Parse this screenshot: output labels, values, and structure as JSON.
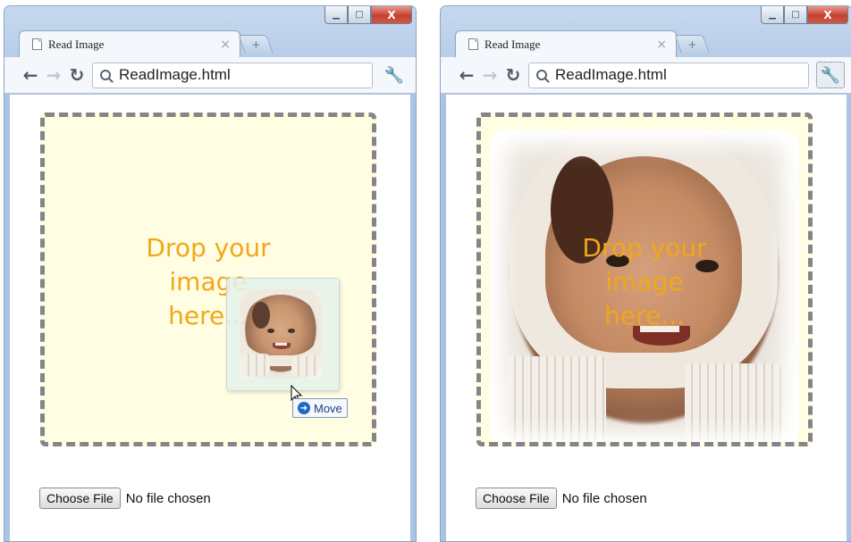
{
  "windows": [
    {
      "tab_title": "Read Image",
      "tab_close": "×",
      "new_tab": "+",
      "address": "ReadImage.html",
      "drop_text": "Drop your\nimage\nhere...",
      "drag_badge": "Move",
      "file_button": "Choose File",
      "file_status": "No file chosen"
    },
    {
      "tab_title": "Read Image",
      "tab_close": "×",
      "new_tab": "+",
      "address": "ReadImage.html",
      "drop_text": "Drop your\nimage\nhere...",
      "file_button": "Choose File",
      "file_status": "No file chosen"
    }
  ],
  "controls": {
    "minimize": "▁",
    "maximize": "□",
    "close": "X"
  },
  "nav": {
    "back": "←",
    "forward": "→",
    "reload": "↻",
    "wrench": "🔧"
  },
  "icons": {
    "tab_page": "page-icon",
    "search": "search-icon",
    "wrench": "wrench-icon",
    "cursor": "arrow-cursor-icon",
    "move": "move-arrow-icon"
  },
  "colors": {
    "dropzone_fill": "#fffde2",
    "dropzone_border": "#858585",
    "drop_text": "#f0a81a",
    "window_frame": "#a9c3e3"
  }
}
